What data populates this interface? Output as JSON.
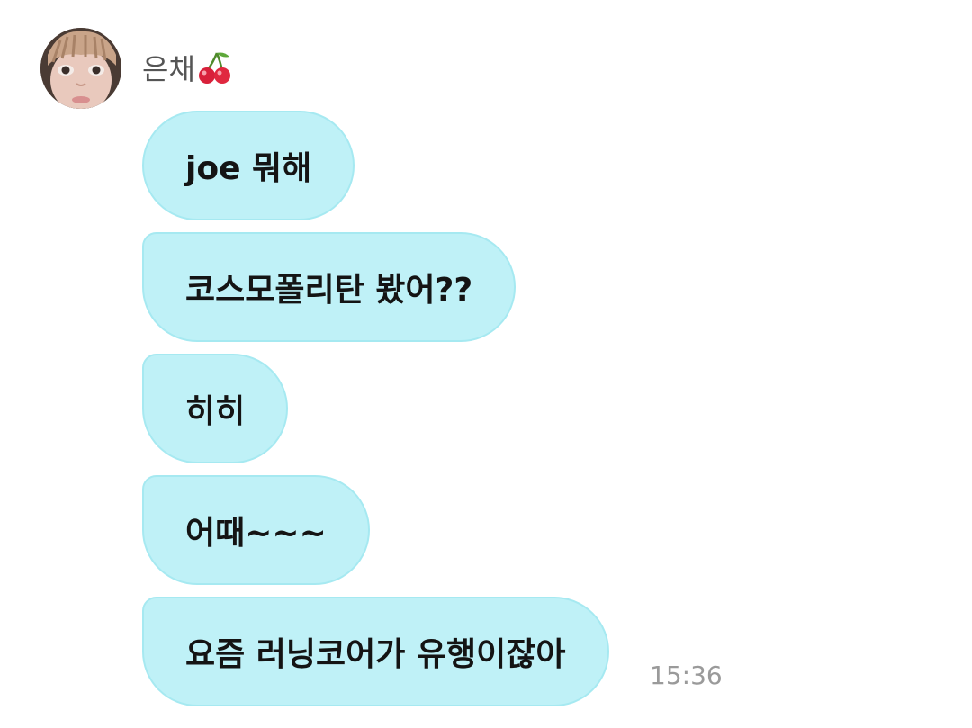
{
  "sender": {
    "name": "은채",
    "emoji_icon": "cherry-icon"
  },
  "messages": [
    {
      "text": "joe 뭐해"
    },
    {
      "text": "코스모폴리탄 봤어??"
    },
    {
      "text": "히히"
    },
    {
      "text": "어때~~~"
    },
    {
      "text": "요즘 러닝코어가 유행이잖아"
    }
  ],
  "timestamp": "15:36",
  "colors": {
    "bubble_background": "#bff1f7",
    "bubble_border": "#a6e9f1",
    "timestamp": "#9a9a9a",
    "sender_name": "#555555"
  }
}
